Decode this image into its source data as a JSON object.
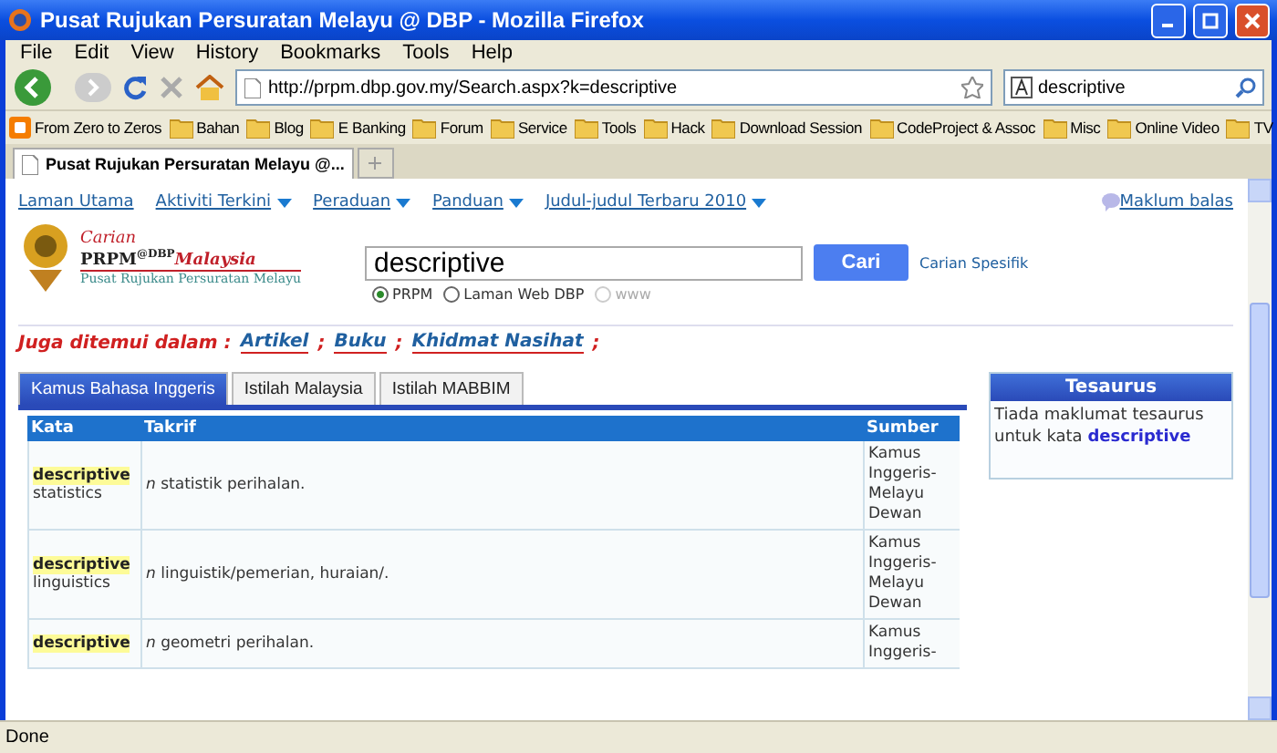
{
  "window": {
    "title": "Pusat Rujukan Persuratan Melayu @ DBP - Mozilla Firefox"
  },
  "menu": [
    "File",
    "Edit",
    "View",
    "History",
    "Bookmarks",
    "Tools",
    "Help"
  ],
  "address": {
    "value": "http://prpm.dbp.gov.my/Search.aspx?k=descriptive"
  },
  "browser_search": {
    "value": "descriptive"
  },
  "bookmarks": [
    {
      "label": "From Zero to Zeros",
      "kind": "feed"
    },
    {
      "label": "Bahan",
      "kind": "folder"
    },
    {
      "label": "Blog",
      "kind": "folder"
    },
    {
      "label": "E Banking",
      "kind": "folder"
    },
    {
      "label": "Forum",
      "kind": "folder"
    },
    {
      "label": "Service",
      "kind": "folder"
    },
    {
      "label": "Tools",
      "kind": "folder"
    },
    {
      "label": "Hack",
      "kind": "folder"
    },
    {
      "label": "Download Session",
      "kind": "folder"
    },
    {
      "label": "CodeProject & Assoc",
      "kind": "folder"
    },
    {
      "label": "Misc",
      "kind": "folder"
    },
    {
      "label": "Online Video",
      "kind": "folder"
    },
    {
      "label": "TV",
      "kind": "folder"
    }
  ],
  "browser_tabs": [
    {
      "label": "Pusat Rujukan Persuratan Melayu @...",
      "selected": true
    }
  ],
  "site_nav": [
    {
      "label": "Laman Utama",
      "has_menu": false
    },
    {
      "label": "Aktiviti Terkini",
      "has_menu": true
    },
    {
      "label": "Peraduan",
      "has_menu": true
    },
    {
      "label": "Panduan",
      "has_menu": true
    },
    {
      "label": "Judul-judul Terbaru 2010",
      "has_menu": true
    }
  ],
  "feedback_link": "Maklum balas",
  "logo": {
    "line_1": "Carian",
    "line_2": "PRPM",
    "line_3": "@DBP",
    "line_4": "Malaysia",
    "line_5": "Pusat Rujukan Persuratan Melayu"
  },
  "search": {
    "value": "descriptive",
    "button": "Cari",
    "advanced_link": "Carian Spesifik"
  },
  "scopes": [
    {
      "label": "PRPM",
      "selected": true,
      "disabled": false
    },
    {
      "label": "Laman Web DBP",
      "selected": false,
      "disabled": false
    },
    {
      "label": "www",
      "selected": false,
      "disabled": true
    }
  ],
  "also_found": {
    "label": "Juga ditemui dalam :",
    "links": [
      "Artikel",
      "Buku",
      "Khidmat Nasihat"
    ],
    "separator": ";"
  },
  "result_tabs": [
    {
      "label": "Kamus Bahasa Inggeris",
      "selected": true
    },
    {
      "label": "Istilah Malaysia",
      "selected": false
    },
    {
      "label": "Istilah MABBIM",
      "selected": false
    }
  ],
  "table": {
    "columns": [
      "Kata",
      "Takrif",
      "Sumber"
    ],
    "rows": [
      {
        "match": "descriptive",
        "rest": "statistics",
        "definition": "*n* statistik perihalan.",
        "source": [
          "Kamus",
          "Inggeris-",
          "Melayu",
          "Dewan"
        ]
      },
      {
        "match": "descriptive",
        "rest": "linguistics",
        "definition": "*n* linguistik/pemerian, huraian/.",
        "source": [
          "Kamus",
          "Inggeris-",
          "Melayu",
          "Dewan"
        ]
      },
      {
        "match": "descriptive",
        "rest": "",
        "definition": "*n* geometri perihalan.",
        "source": [
          "Kamus",
          "Inggeris-"
        ]
      }
    ]
  },
  "thesaurus": {
    "title": "Tesaurus",
    "text": "Tiada maklumat tesaurus untuk kata",
    "word": "descriptive"
  },
  "status_bar": "Done"
}
